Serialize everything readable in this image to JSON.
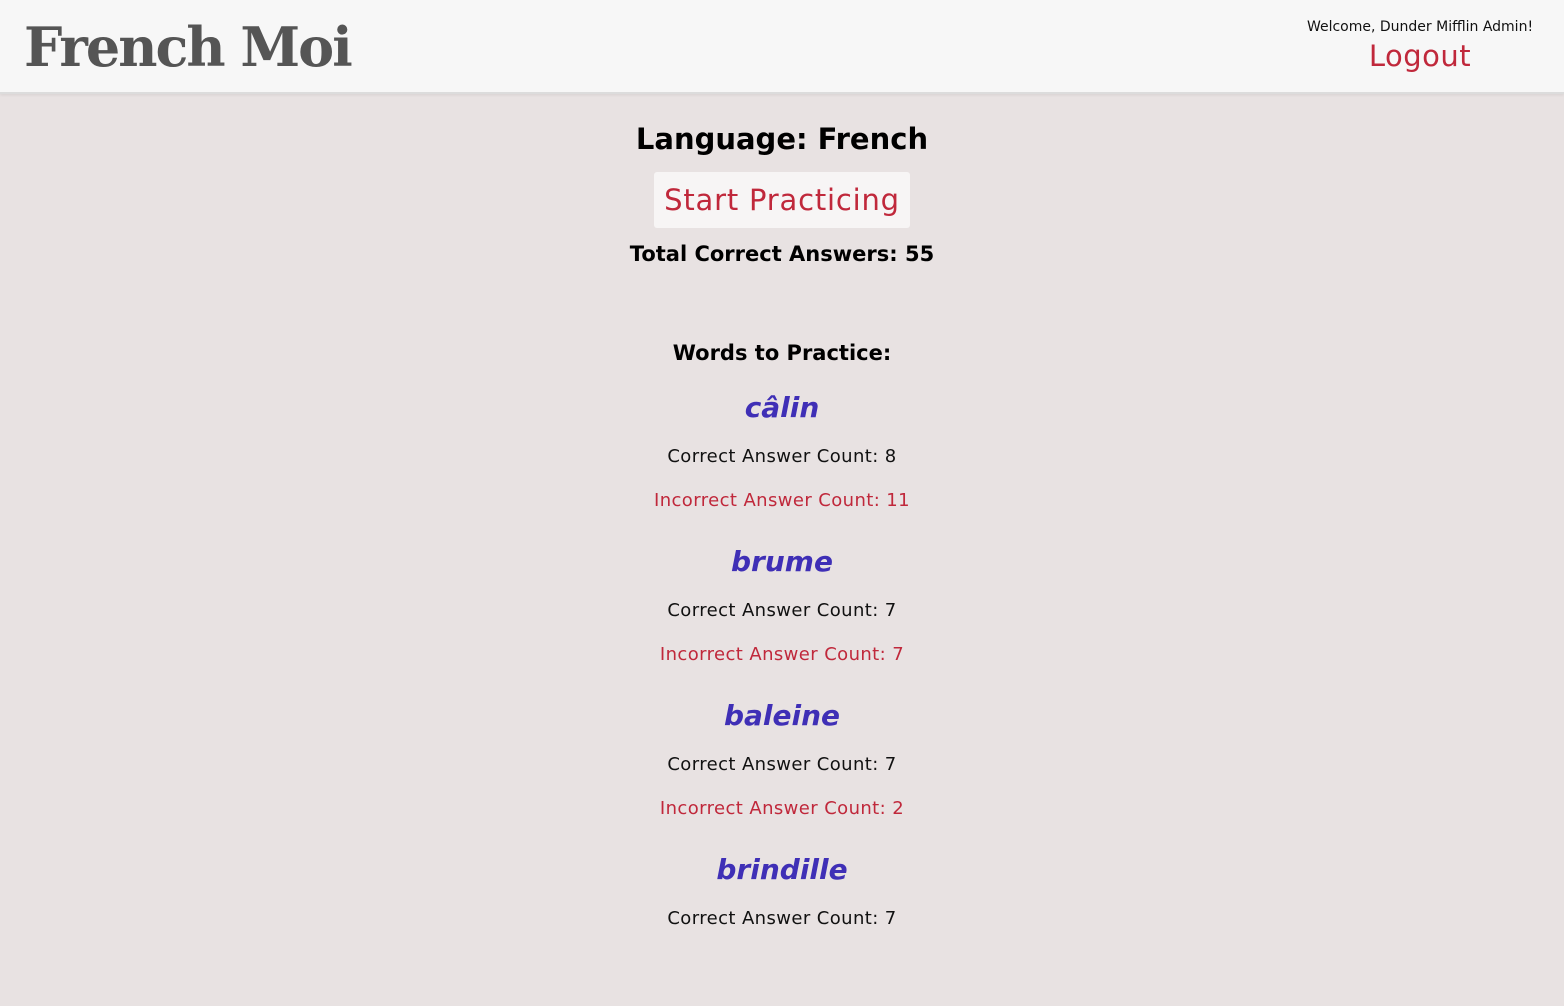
{
  "header": {
    "logo_text": "French Moi",
    "welcome_text": "Welcome, Dunder Mifflin Admin!",
    "logout_label": "Logout"
  },
  "main": {
    "language_label": "Language: French",
    "start_button_label": "Start Practicing",
    "total_correct_text": "Total Correct Answers: 55",
    "words_heading": "Words to Practice:",
    "words": [
      {
        "word": "câlin",
        "correct_text": "Correct Answer Count: 8",
        "incorrect_text": "Incorrect Answer Count: 11"
      },
      {
        "word": "brume",
        "correct_text": "Correct Answer Count: 7",
        "incorrect_text": "Incorrect Answer Count: 7"
      },
      {
        "word": "baleine",
        "correct_text": "Correct Answer Count: 7",
        "incorrect_text": "Incorrect Answer Count: 2"
      },
      {
        "word": "brindille",
        "correct_text": "Correct Answer Count: 7",
        "incorrect_text": ""
      }
    ]
  },
  "colors": {
    "background": "#e8e2e2",
    "header_background": "#f7f7f7",
    "accent_red": "#c0283b",
    "word_purple": "#3f2fb6",
    "logo_gray": "#555555"
  }
}
